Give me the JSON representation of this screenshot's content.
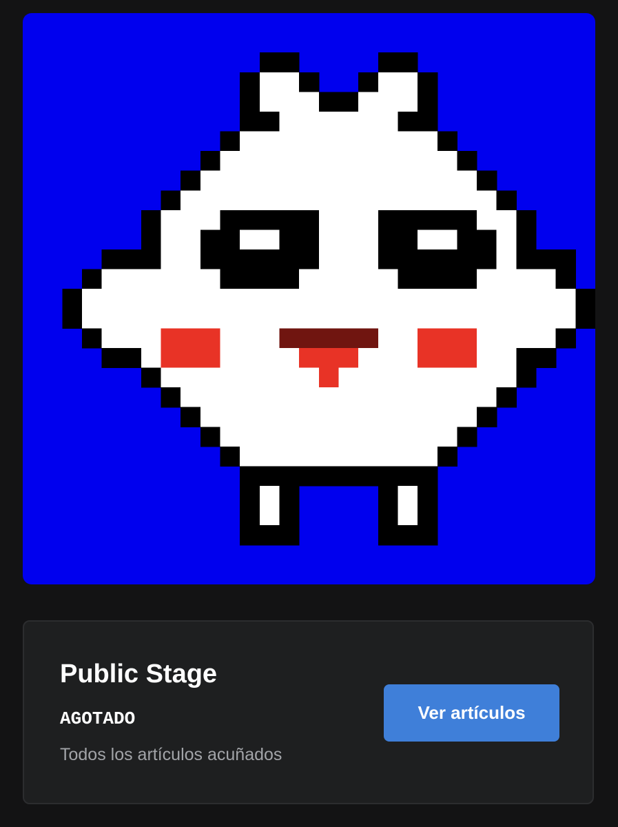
{
  "artwork": {
    "image_name": "pixel-creature",
    "colors": {
      "background": "#0000ee",
      "outline": "#000000",
      "body": "#ffffff",
      "cheeks": "#e83326",
      "mouth": "#701510",
      "tongue": "#e83326"
    }
  },
  "stage": {
    "name": "Public Stage",
    "status": "AGOTADO",
    "description": "Todos los artículos acuñados",
    "button_label": "Ver artículos",
    "button_color": "#3f7fd9"
  }
}
